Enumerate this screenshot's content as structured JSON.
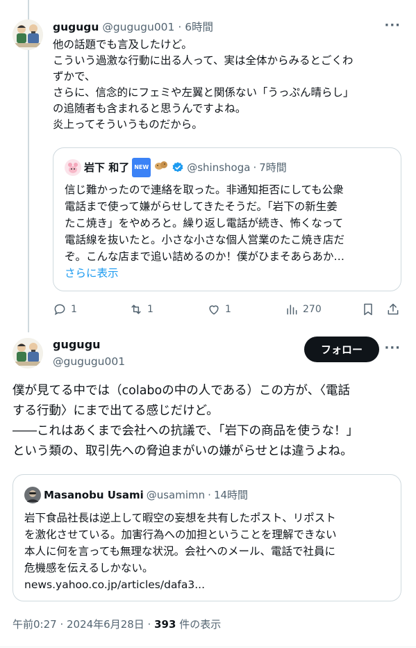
{
  "reply_tweet": {
    "author_name": "gugugu",
    "author_handle": "@gugugu001",
    "separator": " · ",
    "time": "6時間",
    "more": "···",
    "lines": [
      "他の話題でも言及したけど。",
      "こういう過激な行動に出る人って、実は全体からみるとごくわ",
      "ずかで、",
      "さらに、信念的にフェミや左翼と関係ない「うっぷん晴らし」",
      "の追随者も含まれると思うんですよね。",
      "炎上ってそういうものだから。"
    ],
    "quoted": {
      "author_name": "岩下 和了",
      "new_badge": "NEW",
      "author_handle": "@shinshoga",
      "time": "7時間",
      "lines": [
        "信じ難かったので連絡を取った。非通知拒否にしても公衆",
        "電話まで使って嫌がらせしてきたそうだ。「岩下の新生姜",
        "たこ焼き」をやめろと。繰り返し電話が続き、怖くなって",
        "電話線を抜いたと。小さな小さな個人営業のたこ焼き店だ",
        "ぞ。こんな店まで追い詰めるのか！僕がひまそあらあか…"
      ],
      "show_more": "さらに表示"
    },
    "actions": {
      "replies": "1",
      "reposts": "1",
      "likes": "1",
      "views": "270"
    }
  },
  "main_tweet": {
    "author_name": "gugugu",
    "author_handle": "@gugugu001",
    "follow_label": "フォロー",
    "more": "···",
    "lines": [
      "僕が見てる中では（colaboの中の人である）この方が、〈電話",
      "する行動〉にまで出てる感じだけど。",
      "――これはあくまで会社への抗議で、「岩下の商品を使うな！」",
      "という類の、取引先への脅迫まがいの嫌がらせとは違うよね。"
    ],
    "quoted": {
      "author_name": "Masanobu Usami",
      "author_handle": "@usamimn",
      "time": "14時間",
      "lines": [
        "岩下食品社長は逆上して暇空の妄想を共有したポスト、リポスト",
        "を激化させている。加害行為への加担ということを理解できない",
        "本人に何を言っても無理な状況。会社へのメール、電話で社員に",
        "危機感を伝えるしかない。",
        "news.yahoo.co.jp/articles/dafa3..."
      ]
    },
    "timestamp": "午前0:27 · 2024年6月28日 · ",
    "view_count": "393",
    "view_suffix": " 件の表示"
  },
  "colors": {
    "text": "#0f1419",
    "muted": "#536471",
    "accent": "#1d9bf0",
    "border": "#cfd9de",
    "verified": "#1d9bf0"
  },
  "icons": [
    "reply-icon",
    "repost-icon",
    "like-icon",
    "views-icon",
    "bookmark-icon",
    "share-icon",
    "verified-badge-icon"
  ]
}
